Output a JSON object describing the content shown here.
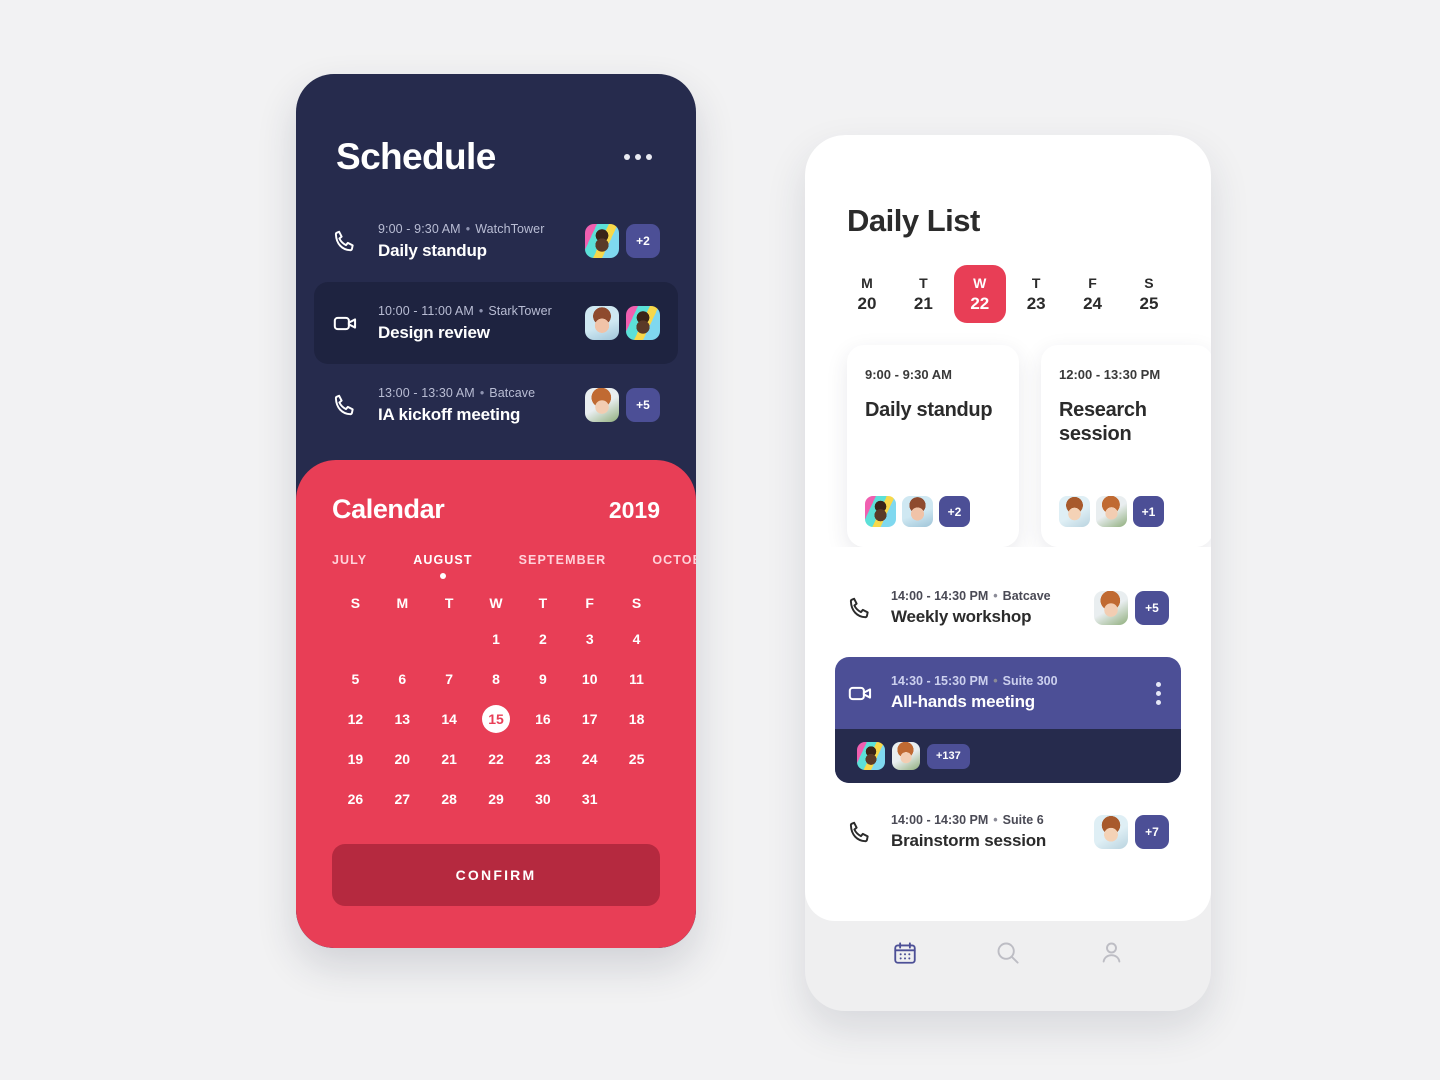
{
  "schedule": {
    "title": "Schedule",
    "menu_icon": "more-horizontal-icon",
    "events": [
      {
        "icon": "phone-icon",
        "time": "9:00 - 9:30 AM",
        "location": "WatchTower",
        "name": "Daily standup",
        "avatars": [
          "ph1"
        ],
        "badge": "+2",
        "active": false
      },
      {
        "icon": "video-icon",
        "time": "10:00 - 11:00 AM",
        "location": "StarkTower",
        "name": "Design review",
        "avatars": [
          "ph2",
          "ph1"
        ],
        "badge": "",
        "active": true
      },
      {
        "icon": "phone-icon",
        "time": "13:00 - 13:30 AM",
        "location": "Batcave",
        "name": "IA kickoff meeting",
        "avatars": [
          "ph3"
        ],
        "badge": "+5",
        "active": false
      }
    ]
  },
  "calendar": {
    "title": "Calendar",
    "year": "2019",
    "months": [
      "JULY",
      "AUGUST",
      "SEPTEMBER",
      "OCTOBER"
    ],
    "selected_month": "AUGUST",
    "weekday_labels": [
      "S",
      "M",
      "T",
      "W",
      "T",
      "F",
      "S"
    ],
    "weeks": [
      [
        "",
        "",
        "",
        "1",
        "2",
        "3",
        "4"
      ],
      [
        "5",
        "6",
        "7",
        "8",
        "9",
        "10",
        "11"
      ],
      [
        "12",
        "13",
        "14",
        "15",
        "16",
        "17",
        "18"
      ],
      [
        "19",
        "20",
        "21",
        "22",
        "23",
        "24",
        "25"
      ],
      [
        "26",
        "27",
        "28",
        "29",
        "30",
        "31",
        ""
      ]
    ],
    "selected_day": "15",
    "confirm_label": "CONFIRM",
    "accent_color": "#e83e56",
    "confirm_color": "#b5293f"
  },
  "daily_list": {
    "title": "Daily List",
    "days": [
      {
        "letter": "M",
        "number": "20",
        "selected": false
      },
      {
        "letter": "T",
        "number": "21",
        "selected": false
      },
      {
        "letter": "W",
        "number": "22",
        "selected": true
      },
      {
        "letter": "T",
        "number": "23",
        "selected": false
      },
      {
        "letter": "F",
        "number": "24",
        "selected": false
      },
      {
        "letter": "S",
        "number": "25",
        "selected": false
      }
    ],
    "cards": [
      {
        "time": "9:00 - 9:30 AM",
        "name": "Daily standup",
        "avatars": [
          "ph1",
          "ph2"
        ],
        "badge": "+2"
      },
      {
        "time": "12:00 - 13:30 PM",
        "name": "Research session",
        "avatars": [
          "ph4",
          "ph3"
        ],
        "badge": "+1"
      }
    ],
    "items": [
      {
        "icon": "phone-icon",
        "time": "14:00 - 14:30 PM",
        "location": "Batcave",
        "name": "Weekly workshop",
        "avatars": [
          "ph3"
        ],
        "badge": "+5"
      },
      {
        "icon": "phone-icon",
        "time": "14:00 - 14:30 PM",
        "location": "Suite 6",
        "name": "Brainstorm session",
        "avatars": [
          "ph4"
        ],
        "badge": "+7"
      }
    ],
    "highlight": {
      "icon": "video-icon",
      "time": "14:30 - 15:30 PM",
      "location": "Suite 300",
      "name": "All-hands meeting",
      "menu_icon": "more-vertical-icon",
      "avatars": [
        "ph1",
        "ph3"
      ],
      "badge": "+137",
      "color": "#4c4f96",
      "footer_color": "#262b4d"
    },
    "nav": [
      {
        "icon": "calendar-icon",
        "active": true
      },
      {
        "icon": "search-icon",
        "active": false
      },
      {
        "icon": "profile-icon",
        "active": false
      }
    ]
  }
}
